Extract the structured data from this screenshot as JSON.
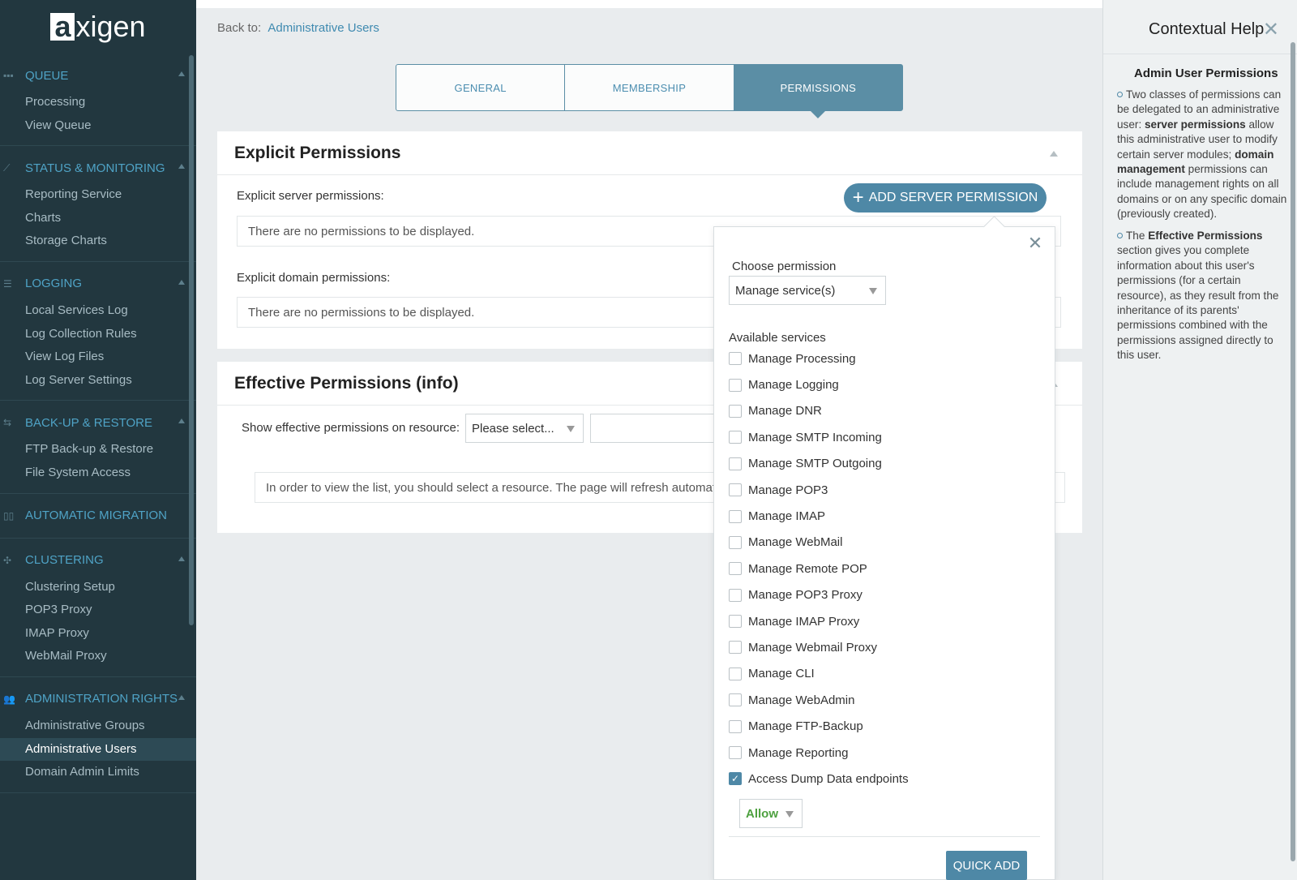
{
  "logo": {
    "first": "a",
    "rest": "xigen"
  },
  "sidebar": {
    "sections": [
      {
        "title": "QUEUE",
        "icon": "queue-icon",
        "items": [
          "Processing",
          "View Queue"
        ]
      },
      {
        "title": "STATUS & MONITORING",
        "icon": "monitoring-icon",
        "items": [
          "Reporting Service",
          "Charts",
          "Storage Charts"
        ]
      },
      {
        "title": "LOGGING",
        "icon": "logging-icon",
        "items": [
          "Local Services Log",
          "Log Collection Rules",
          "View Log Files",
          "Log Server Settings"
        ]
      },
      {
        "title": "BACK-UP & RESTORE",
        "icon": "backup-icon",
        "items": [
          "FTP Back-up & Restore",
          "File System Access"
        ]
      },
      {
        "title": "AUTOMATIC MIGRATION",
        "icon": "migration-icon",
        "items": []
      },
      {
        "title": "CLUSTERING",
        "icon": "clustering-icon",
        "items": [
          "Clustering Setup",
          "POP3 Proxy",
          "IMAP Proxy",
          "WebMail Proxy"
        ]
      },
      {
        "title": "ADMINISTRATION RIGHTS",
        "icon": "admin-rights-icon",
        "items": [
          "Administrative Groups",
          "Administrative Users",
          "Domain Admin Limits"
        ]
      }
    ],
    "active_item": "Administrative Users"
  },
  "breadcrumb": {
    "prefix": "Back to:",
    "link": "Administrative Users"
  },
  "tabs": [
    {
      "label": "GENERAL",
      "active": false
    },
    {
      "label": "MEMBERSHIP",
      "active": false
    },
    {
      "label": "PERMISSIONS",
      "active": true
    }
  ],
  "explicit": {
    "title": "Explicit Permissions",
    "server_label": "Explicit server permissions:",
    "server_empty": "There are no permissions to be displayed.",
    "domain_label": "Explicit domain permissions:",
    "domain_empty": "There are no permissions to be displayed.",
    "add_button": "ADD SERVER PERMISSION"
  },
  "effective": {
    "title": "Effective Permissions (info)",
    "resource_label": "Show effective permissions on resource:",
    "resource_select": "Please select...",
    "info": "In order to view the list, you should select a resource. The page will refresh automat"
  },
  "popup": {
    "choose_label": "Choose permission",
    "choose_value": "Manage service(s)",
    "available_label": "Available services",
    "services": [
      {
        "label": "Manage Processing",
        "checked": false
      },
      {
        "label": "Manage Logging",
        "checked": false
      },
      {
        "label": "Manage DNR",
        "checked": false
      },
      {
        "label": "Manage SMTP Incoming",
        "checked": false
      },
      {
        "label": "Manage SMTP Outgoing",
        "checked": false
      },
      {
        "label": "Manage POP3",
        "checked": false
      },
      {
        "label": "Manage IMAP",
        "checked": false
      },
      {
        "label": "Manage WebMail",
        "checked": false
      },
      {
        "label": "Manage Remote POP",
        "checked": false
      },
      {
        "label": "Manage POP3 Proxy",
        "checked": false
      },
      {
        "label": "Manage IMAP Proxy",
        "checked": false
      },
      {
        "label": "Manage Webmail Proxy",
        "checked": false
      },
      {
        "label": "Manage CLI",
        "checked": false
      },
      {
        "label": "Manage WebAdmin",
        "checked": false
      },
      {
        "label": "Manage FTP-Backup",
        "checked": false
      },
      {
        "label": "Manage Reporting",
        "checked": false
      },
      {
        "label": "Access Dump Data endpoints",
        "checked": true
      }
    ],
    "allow_value": "Allow",
    "quick_add": "QUICK ADD"
  },
  "help": {
    "title": "Contextual Help",
    "subtitle": "Admin User Permissions",
    "p1_a": "Two classes of permissions can be delegated to an administrative user: ",
    "p1_b": "server permissions",
    "p1_c": " allow this administrative user to modify certain server modules; ",
    "p1_d": "domain management",
    "p1_e": " permissions can include management rights on all domains or on any specific domain (previously created).",
    "p2_a": "The ",
    "p2_b": "Effective Permissions",
    "p2_c": " section gives you complete information about this user's permissions (for a certain resource), as they result from the inheritance of its parents' permissions combined with the permissions assigned directly to this user."
  },
  "colors": {
    "sidebar_bg": "#22373f",
    "accent": "#4e88a6",
    "link": "#3f8ab0",
    "allow": "#4ea140"
  }
}
